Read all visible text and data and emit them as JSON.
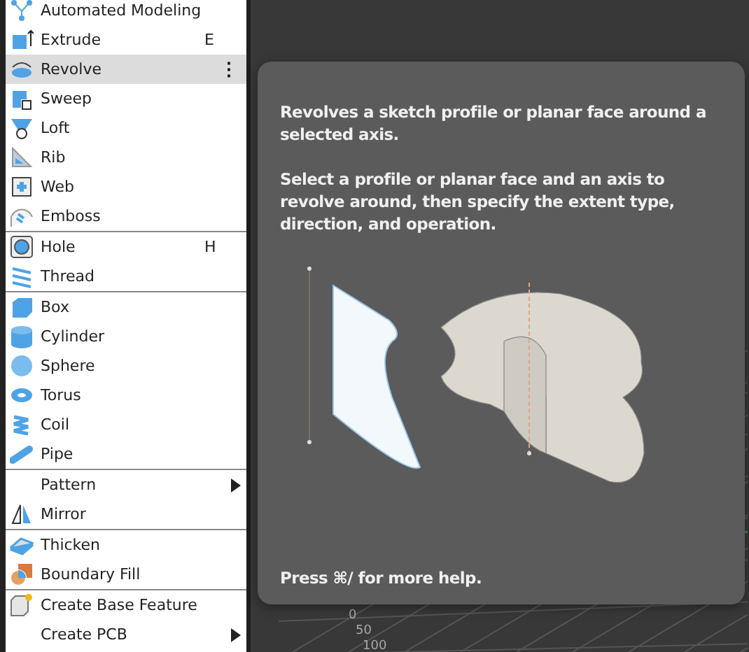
{
  "menu": {
    "groups": [
      {
        "items": [
          {
            "label": "Automated Modeling",
            "selected": false,
            "submenu": false
          },
          {
            "label": "Extrude",
            "shortcut": "E",
            "selected": false,
            "submenu": false
          },
          {
            "label": "Revolve",
            "selected": true,
            "submenu": false,
            "more": "⋮"
          },
          {
            "label": "Sweep",
            "selected": false,
            "submenu": false
          },
          {
            "label": "Loft",
            "selected": false,
            "submenu": false
          },
          {
            "label": "Rib",
            "selected": false,
            "submenu": false
          },
          {
            "label": "Web",
            "selected": false,
            "submenu": false
          },
          {
            "label": "Emboss",
            "selected": false,
            "submenu": false
          }
        ]
      },
      {
        "items": [
          {
            "label": "Hole",
            "shortcut": "H",
            "selected": false,
            "submenu": false
          },
          {
            "label": "Thread",
            "selected": false,
            "submenu": false
          }
        ]
      },
      {
        "items": [
          {
            "label": "Box",
            "selected": false,
            "submenu": false
          },
          {
            "label": "Cylinder",
            "selected": false,
            "submenu": false
          },
          {
            "label": "Sphere",
            "selected": false,
            "submenu": false
          },
          {
            "label": "Torus",
            "selected": false,
            "submenu": false
          },
          {
            "label": "Coil",
            "selected": false,
            "submenu": false
          },
          {
            "label": "Pipe",
            "selected": false,
            "submenu": false
          }
        ]
      },
      {
        "items": [
          {
            "label": "Pattern",
            "selected": false,
            "submenu": true
          },
          {
            "label": "Mirror",
            "selected": false,
            "submenu": false
          }
        ]
      },
      {
        "items": [
          {
            "label": "Thicken",
            "selected": false,
            "submenu": false
          },
          {
            "label": "Boundary Fill",
            "selected": false,
            "submenu": false
          }
        ]
      },
      {
        "items": [
          {
            "label": "Create Base Feature",
            "selected": false,
            "submenu": false
          },
          {
            "label": "Create PCB",
            "selected": false,
            "submenu": true
          }
        ]
      }
    ]
  },
  "tooltip": {
    "paragraphs": [
      "Revolves a sketch profile or planar face around a selected axis.",
      "Select a profile or planar face and an axis to revolve around, then specify the extent type, direction, and operation."
    ],
    "footer": "Press ⌘/ for more help."
  },
  "viewport": {
    "grid_labels": [
      "0",
      "50",
      "100"
    ]
  }
}
